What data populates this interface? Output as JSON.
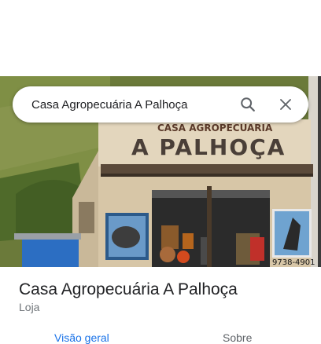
{
  "search": {
    "query": "Casa Agropecuária A Palhoça",
    "search_icon": "search-icon",
    "close_icon": "close-icon"
  },
  "photo": {
    "sign_small": "CASA AGROPECUARIA",
    "sign_big": "A PALHOÇA",
    "phone_fragment": "9738-4901"
  },
  "place": {
    "title": "Casa Agropecuária A Palhoça",
    "category": "Loja"
  },
  "tabs": [
    {
      "label": "Visão geral",
      "active": true
    },
    {
      "label": "Sobre",
      "active": false
    }
  ],
  "colors": {
    "accent": "#1a73e8",
    "text_primary": "#202124",
    "text_secondary": "#70757a"
  }
}
